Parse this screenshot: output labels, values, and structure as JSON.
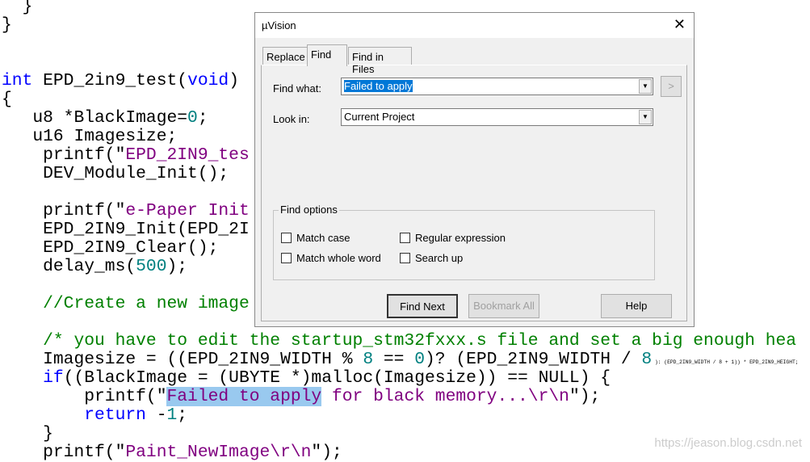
{
  "code_lines": [
    [
      [
        "  }",
        ""
      ]
    ],
    [
      [
        "}",
        ""
      ]
    ],
    [],
    [],
    [
      [
        "int",
        "kw"
      ],
      [
        " EPD_2in9_test(",
        ""
      ],
      [
        "void",
        "kw"
      ],
      [
        ")",
        ""
      ]
    ],
    [
      [
        "{",
        ""
      ]
    ],
    [
      [
        "   u8 *BlackImage=",
        ""
      ],
      [
        "0",
        "num"
      ],
      [
        ";",
        ""
      ]
    ],
    [
      [
        "   u16 Imagesize;",
        ""
      ]
    ],
    [
      [
        "    printf(\"",
        ""
      ],
      [
        "EPD_2IN9_tes",
        "str"
      ]
    ],
    [
      [
        "    DEV_Module_Init();",
        ""
      ]
    ],
    [],
    [
      [
        "    printf(\"",
        ""
      ],
      [
        "e-Paper Init",
        "str"
      ]
    ],
    [
      [
        "    EPD_2IN9_Init(EPD_2I",
        ""
      ]
    ],
    [
      [
        "    EPD_2IN9_Clear();",
        ""
      ]
    ],
    [
      [
        "    delay_ms(",
        ""
      ],
      [
        "500",
        "num"
      ],
      [
        ");",
        ""
      ]
    ],
    [],
    [
      [
        "    ",
        ""
      ],
      [
        "//Create a new image",
        "cm"
      ]
    ],
    [],
    [
      [
        "    ",
        ""
      ],
      [
        "/* you have to edit the startup_stm32fxxx.s file and set a big enough hea",
        "cm"
      ]
    ],
    [
      [
        "    Imagesize = ((EPD_2IN9_WIDTH % ",
        ""
      ],
      [
        "8",
        "num"
      ],
      [
        " == ",
        ""
      ],
      [
        "0",
        "num"
      ],
      [
        ")? (EPD_2IN9_WIDTH / ",
        ""
      ],
      [
        "8",
        "num"
      ],
      [
        " ): (EPD_2IN9_WIDTH / 8 + 1)) * EPD_2IN9_HEIGHT;",
        ""
      ]
    ],
    [
      [
        "    ",
        ""
      ],
      [
        "if",
        "kw"
      ],
      [
        "((BlackImage = (UBYTE *)malloc(Imagesize)) == NULL) {",
        ""
      ]
    ],
    [
      [
        "        printf(\"",
        ""
      ],
      [
        "Failed to apply",
        "str hl"
      ],
      [
        " for black memory...\\r\\n",
        "str"
      ],
      [
        "\");",
        ""
      ]
    ],
    [
      [
        "        ",
        ""
      ],
      [
        "return",
        "kw"
      ],
      [
        " -",
        ""
      ],
      [
        "1",
        "num"
      ],
      [
        ";",
        ""
      ]
    ],
    [
      [
        "    }",
        ""
      ]
    ],
    [
      [
        "    printf(\"",
        ""
      ],
      [
        "Paint_NewImage\\r\\n",
        "str"
      ],
      [
        "\");",
        ""
      ]
    ]
  ],
  "dialog": {
    "title": "µVision",
    "tabs": [
      "Replace",
      "Find",
      "Find in Files"
    ],
    "find_what_label": "Find what:",
    "find_what_value": "Failed to apply",
    "look_in_label": "Look in:",
    "look_in_value": "Current Project",
    "more_button": ">",
    "find_options_label": "Find options",
    "options": [
      "Match case",
      "Match whole word",
      "Regular expression",
      "Search up"
    ],
    "buttons": {
      "find_next": "Find Next",
      "bookmark_all": "Bookmark All",
      "help": "Help"
    }
  },
  "watermark": "https://jeason.blog.csdn.net"
}
